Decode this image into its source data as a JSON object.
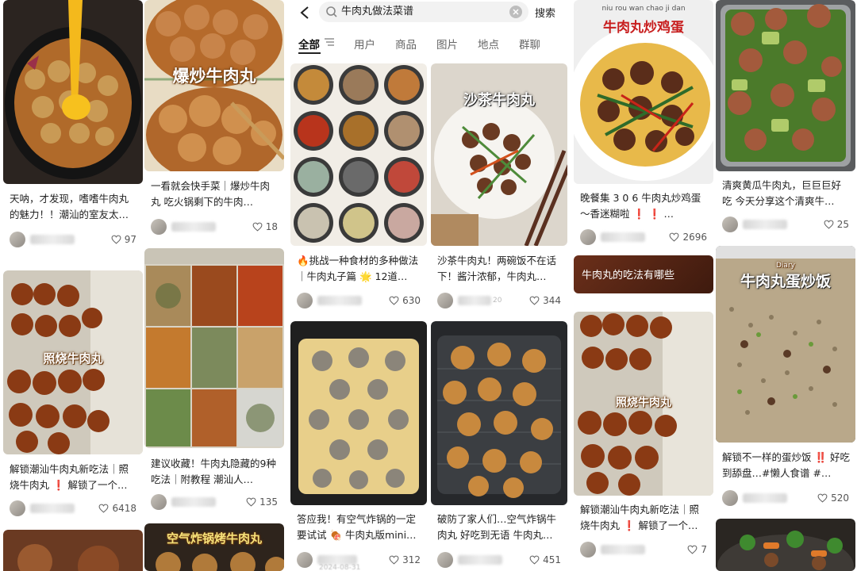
{
  "search": {
    "query": "牛肉丸做法菜谱",
    "button": "搜索"
  },
  "tabs": [
    {
      "label": "全部",
      "active": true
    },
    {
      "label": "用户"
    },
    {
      "label": "商品"
    },
    {
      "label": "图片"
    },
    {
      "label": "地点"
    },
    {
      "label": "群聊"
    }
  ],
  "feed": {
    "col1": [
      {
        "title": "天呐，才发现，嗜嗜牛肉丸的魅力！！潮汕的室友太…",
        "likes": "97"
      },
      {
        "title": "解锁潮汕牛肉丸新吃法｜照烧牛肉丸 ❗ 解锁了一个…",
        "likes": "6418",
        "overlay": "照烧牛肉丸"
      }
    ],
    "col2": [
      {
        "title": "一看就会快手菜｜爆炒牛肉丸 吃火锅剩下的牛肉…",
        "likes": "18",
        "overlay": "爆炒牛肉丸"
      },
      {
        "title": "建议收藏！牛肉丸隐藏的9种吃法｜附教程 潮汕人…",
        "likes": "135"
      },
      {
        "overlay": "空气炸锅烤牛肉丸"
      }
    ],
    "phone_left": [
      {
        "title": "🔥挑战一种食材的多种做法｜牛肉丸子篇 🌟 12道…",
        "likes": "630"
      },
      {
        "title": "答应我！有空气炸锅的一定要试试 🍖 牛肉丸版mini…",
        "likes": "312",
        "date": "2024-08-31"
      }
    ],
    "phone_right": [
      {
        "title": "沙茶牛肉丸！两碗饭不在话下！酱汁浓郁，牛肉丸…",
        "likes": "344",
        "overlay": "沙茶牛肉丸",
        "date": "20"
      },
      {
        "title": "破防了家人们…空气炸锅牛肉丸 好吃到无语 牛肉丸…",
        "likes": "451"
      }
    ],
    "col5": [
      {
        "title": "晚餐集 3 0 6 牛肉丸炒鸡蛋～香迷糊啦 ❗ ❗ …",
        "likes": "2696",
        "overlay": "牛肉丸炒鸡蛋",
        "overlay_sub": "niu rou wan chao ji dan"
      },
      {
        "chip": "牛肉丸的吃法有哪些"
      },
      {
        "title": "解锁潮汕牛肉丸新吃法｜照烧牛肉丸 ❗ 解锁了一个…",
        "likes": "7",
        "overlay": "照烧牛肉丸"
      }
    ],
    "col6": [
      {
        "title": "清爽黄瓜牛肉丸，巨巨巨好吃 今天分享这个清爽牛…",
        "likes": "25"
      },
      {
        "title": "解锁不一样的蛋炒饭 ‼️ 好吃到舔盘…#懒人食谱 #…",
        "likes": "520",
        "overlay": "牛肉丸蛋炒饭",
        "overlay_sub": "Diary"
      }
    ]
  },
  "colors": {
    "background": "#ffffff",
    "search_bg": "#f2f2f2",
    "text": "#222222",
    "muted": "#666666"
  },
  "icons": [
    "back-arrow-icon",
    "search-icon",
    "clear-icon",
    "filter-icon",
    "heart-icon"
  ]
}
